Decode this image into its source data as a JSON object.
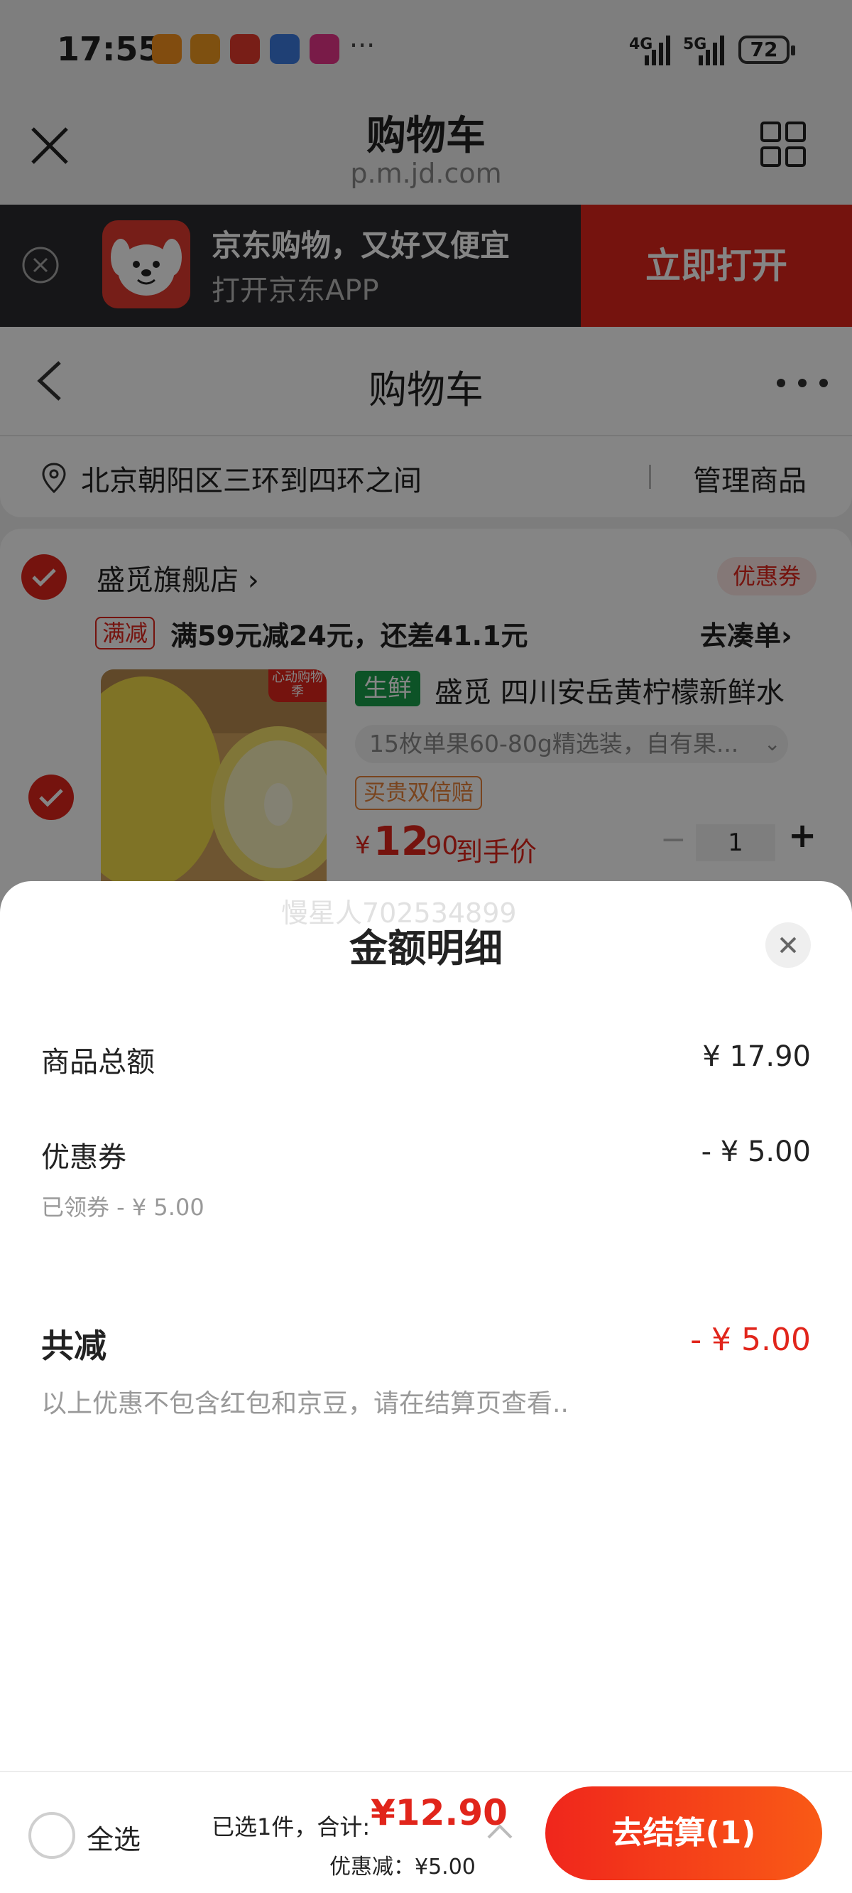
{
  "status_bar": {
    "time": "17:55",
    "more": "···",
    "net1": "4G",
    "net2": "5G",
    "battery": "72",
    "app_icons": [
      "heart-app-icon",
      "bag-app-icon",
      "food-app-icon",
      "shield-app-icon",
      "pink-app-icon"
    ]
  },
  "browser": {
    "title": "购物车",
    "url": "p.m.jd.com"
  },
  "app_banner": {
    "line1": "京东购物，又好又便宜",
    "line2": "打开京东APP",
    "open_label": "立即打开"
  },
  "page": {
    "nav_title": "购物车",
    "address": "北京朝阳区三环到四环之间",
    "manage_label": "管理商品",
    "shop": {
      "name": "盛觅旗舰店 ›",
      "coupon_label": "优惠券",
      "promo_tag": "满减",
      "promo_text": "满59元减24元，还差41.1元",
      "promo_go": "去凑单›"
    },
    "product": {
      "img_badge": "心动购物季",
      "fresh_tag": "生鲜",
      "title": "盛觅 四川安岳黄柠檬新鲜水",
      "spec": "15枚单果60-80g精选装，自有果...",
      "guarantee": "买贵双倍赔",
      "price_currency": "¥",
      "price_int": "12",
      "price_dec": ".90",
      "price_label": "到手价",
      "qty_minus": "−",
      "qty": "1",
      "qty_plus": "+"
    }
  },
  "sheet": {
    "watermark": "慢星人702534899",
    "title": "金额明细",
    "rows": [
      {
        "label": "商品总额",
        "value": "¥ 17.90"
      },
      {
        "label": "优惠券",
        "value": "- ¥ 5.00",
        "sub": "已领券 - ¥ 5.00"
      }
    ],
    "total_label": "共减",
    "total_value": "- ¥ 5.00",
    "note": "以上优惠不包含红包和京豆，请在结算页查看.."
  },
  "footer": {
    "select_all": "全选",
    "summary": "已选1件，合计:",
    "total": "¥12.90",
    "discount": "优惠减：¥5.00",
    "checkout": "去结算(1)"
  },
  "colors": {
    "brand_red": "#e1251b",
    "fresh_green": "#1aa04b",
    "banner_dark": "#2b2b2e"
  }
}
